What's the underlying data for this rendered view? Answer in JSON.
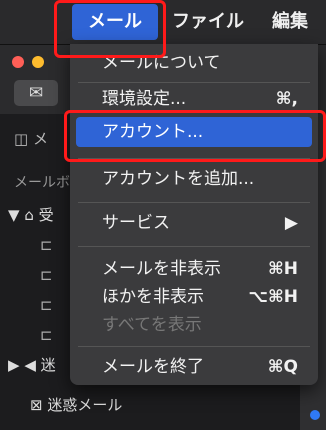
{
  "menubar": {
    "apple_icon": "apple-logo-icon",
    "items": [
      {
        "label": "メール"
      },
      {
        "label": "ファイル"
      },
      {
        "label": "編集"
      }
    ]
  },
  "window": {
    "envelope_icon": "envelope-icon",
    "sidebar_label": "メールボ",
    "row_prefix": "メ",
    "rows": [
      {
        "label": "受"
      },
      {
        "label": "迷"
      },
      {
        "label": "迷惑メール"
      }
    ]
  },
  "menu": {
    "items": [
      {
        "label": "メールについて",
        "shortcut": ""
      },
      {
        "label": "環境設定...",
        "shortcut": "⌘,"
      },
      {
        "label": "アカウント...",
        "shortcut": ""
      },
      {
        "label": "アカウントを追加...",
        "shortcut": ""
      },
      {
        "label": "サービス",
        "shortcut": "▶"
      },
      {
        "label": "メールを非表示",
        "shortcut": "⌘H"
      },
      {
        "label": "ほかを非表示",
        "shortcut": "⌥⌘H"
      },
      {
        "label": "すべてを表示",
        "shortcut": ""
      },
      {
        "label": "メールを終了",
        "shortcut": "⌘Q"
      }
    ]
  },
  "colors": {
    "highlight": "#2f64d6",
    "annotation_red": "#ff1a1a"
  }
}
